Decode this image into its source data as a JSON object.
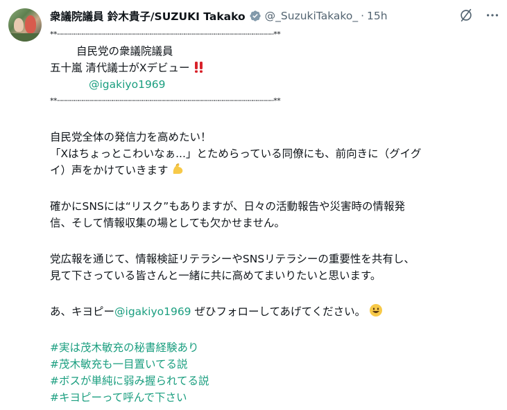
{
  "author": {
    "display_name": "衆議院議員 鈴木貴子/SUZUKI Takako",
    "handle": "@_SuzukiTakako_",
    "separator": "·",
    "time": "15h"
  },
  "icons": {
    "avatar": "profile-photo",
    "verified": "verified-badge-icon",
    "grok": "grok-icon",
    "more": "more-options-icon",
    "exclamation": "double-exclamation-emoji",
    "muscle": "flexed-biceps-emoji",
    "smile": "grinning-face-emoji"
  },
  "colors": {
    "text": "#0f1419",
    "muted": "#536471",
    "link": "#1a9e7f",
    "verified": "#829aab"
  },
  "post": {
    "rule_top": "**┈┈┈┈┈┈┈┈┈┈┈┈┈┈┈┈┈┈┈┈┈┈┈┈┈┈┈┈┈┈┈┈┈┈┈┈┈┈┈┈┈┈┈┈┈┈┈┈┈┈┈**",
    "intro_line1": "自民党の衆議院議員",
    "intro_line2": "五十嵐 清代議士がXデビュー",
    "intro_mention": "@igakiyo1969",
    "rule_bottom": "**┈┈┈┈┈┈┈┈┈┈┈┈┈┈┈┈┈┈┈┈┈┈┈┈┈┈┈┈┈┈┈┈┈┈┈┈┈┈┈┈┈┈┈┈┈┈┈┈┈┈┈**",
    "p1_line1": "自民党全体の発信力を高めたい！",
    "p1_line2": "「Xはちょっとこわいなぁ...」とためらっている同僚にも、前向きに（グイグ",
    "p1_line3": "イ）声をかけていきます",
    "p2_line1": "確かにSNSには“リスク”もありますが、日々の活動報告や災害時の情報発",
    "p2_line2": "信、そして情報収集の場としても欠かせません。",
    "p3_line1": "党広報を通じて、情報検証リテラシーやSNSリテラシーの重要性を共有し、",
    "p3_line2": "見て下さっている皆さんと一緒に共に高めてまいりたいと思います。",
    "p4_prefix": "あ、キヨピー",
    "p4_mention": "@igakiyo1969",
    "p4_suffix": " ぜひフォローしてあげてください。",
    "hashtags": [
      "#実は茂木敏充の秘書経験あり",
      "#茂木敏充も一目置いてる説",
      "#ボスが単純に弱み握られてる説",
      "#キヨピーって呼んで下さい"
    ]
  }
}
